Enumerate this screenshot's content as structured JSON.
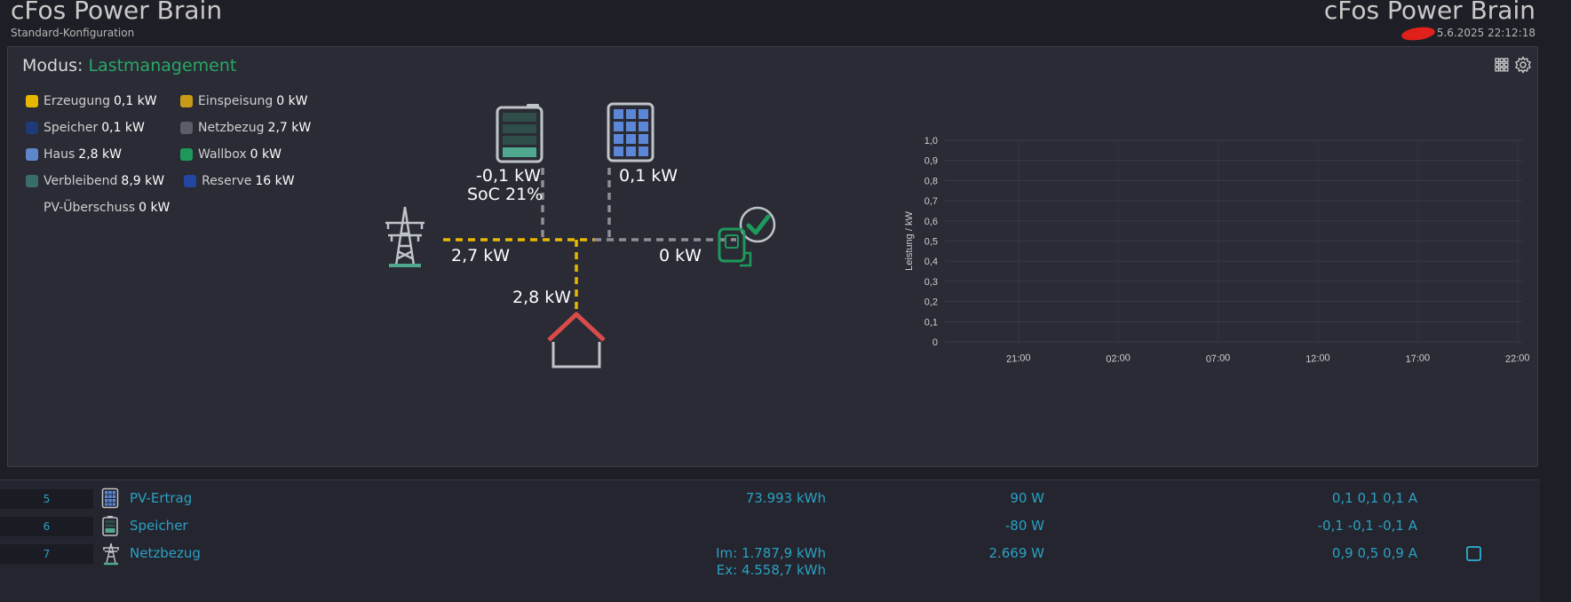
{
  "header": {
    "title_left": "cFos Power Brain",
    "subtitle": "Standard-Konfiguration",
    "title_right": "cFos Power Brain",
    "datetime": "5.6.2025 22:12:18"
  },
  "panel": {
    "mode_label": "Modus:",
    "mode_value": "Lastmanagement",
    "icons": [
      "grid-icon",
      "gear-icon"
    ]
  },
  "legend": [
    [
      {
        "label": "Erzeugung",
        "value": "0,1 kW",
        "color": "#e6b800"
      },
      {
        "label": "Einspeisung",
        "value": "0 kW",
        "color": "#c99a17"
      }
    ],
    [
      {
        "label": "Speicher",
        "value": "0,1 kW",
        "color": "#1e3a78"
      },
      {
        "label": "Netzbezug",
        "value": "2,7 kW",
        "color": "#5b5e66"
      }
    ],
    [
      {
        "label": "Haus",
        "value": "2,8 kW",
        "color": "#5f86c9"
      },
      {
        "label": "Wallbox",
        "value": "0 kW",
        "color": "#1d9a5b"
      }
    ],
    [
      {
        "label": "Verbleibend",
        "value": "8,9 kW",
        "color": "#3b6c6c"
      },
      {
        "label": "Reserve",
        "value": "16 kW",
        "color": "#2346a2"
      }
    ],
    [
      {
        "label": "PV-Überschuss",
        "value": "0 kW",
        "color": ""
      }
    ]
  ],
  "flow": {
    "battery_power": "-0,1 kW",
    "battery_soc": "SoC 21%",
    "solar_power": "0,1 kW",
    "grid_power": "2,7 kW",
    "wallbox_power": "0 kW",
    "house_power": "2,8 kW"
  },
  "chart_data": {
    "type": "line",
    "ylabel": "Leistung / kW",
    "ylim": [
      0,
      1.0
    ],
    "yticks": [
      "0",
      "0,1",
      "0,2",
      "0,3",
      "0,4",
      "0,5",
      "0,6",
      "0,7",
      "0,8",
      "0,9",
      "1,0"
    ],
    "xticks": [
      "21:00",
      "02:00",
      "07:00",
      "12:00",
      "17:00",
      "22:00"
    ],
    "series": [],
    "grid": true
  },
  "table": {
    "rows": [
      {
        "num": "5",
        "icon": "solar-panel-icon",
        "name": "PV-Ertrag",
        "energy": [
          "73.993 kWh"
        ],
        "power": "90 W",
        "amps": "0,1 0,1 0,1 A",
        "checkbox": false
      },
      {
        "num": "6",
        "icon": "battery-icon",
        "name": "Speicher",
        "energy": [],
        "power": "-80 W",
        "amps": "-0,1 -0,1 -0,1 A",
        "checkbox": false
      },
      {
        "num": "7",
        "icon": "power-tower-icon",
        "name": "Netzbezug",
        "energy": [
          "Im: 1.787,9 kWh",
          "Ex: 4.558,7 kWh"
        ],
        "power": "2.669 W",
        "amps": "0,9 0,5 0,9 A",
        "checkbox": true
      }
    ]
  }
}
